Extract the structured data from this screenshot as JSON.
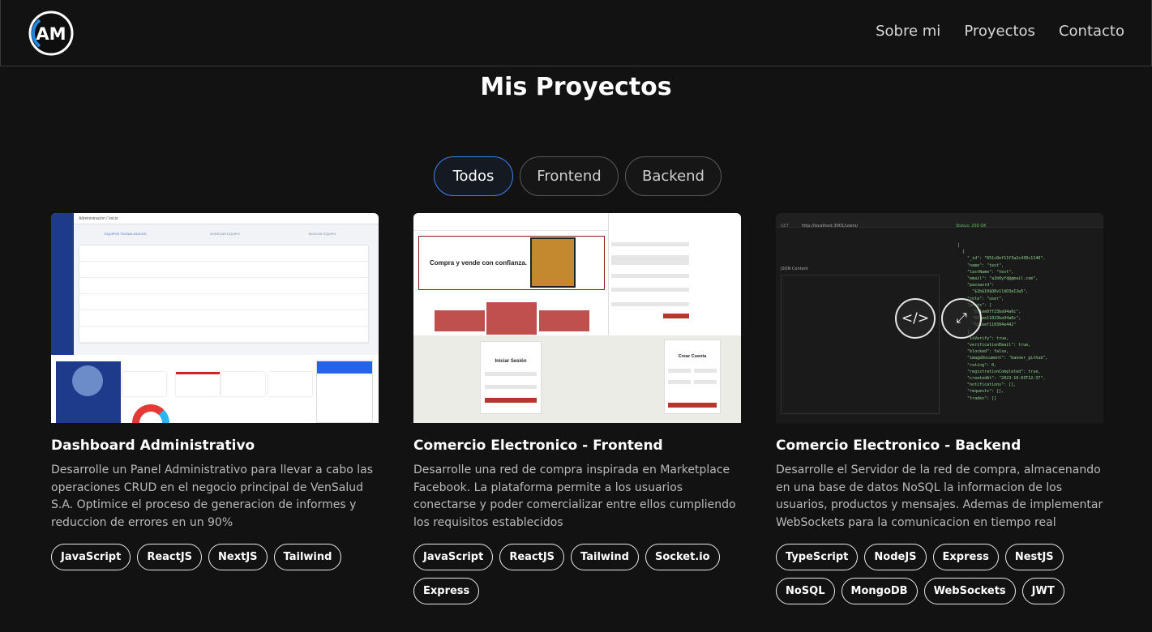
{
  "header": {
    "logo_text": "AM",
    "nav": [
      "Sobre mi",
      "Proyectos",
      "Contacto"
    ]
  },
  "page_title": "Mis Proyectos",
  "filters": [
    "Todos",
    "Frontend",
    "Backend"
  ],
  "active_filter": "Todos",
  "projects": [
    {
      "title": "Dashboard Administrativo",
      "description": "Desarrolle un Panel Administrativo para llevar a cabo las operaciones CRUD en el negocio principal de VenSalud S.A. Optimice el proceso de generacion de informes y reduccion de errores en un 90%",
      "tags": [
        "JavaScript",
        "ReactJS",
        "NextJS",
        "Tailwind"
      ]
    },
    {
      "title": "Comercio Electronico - Frontend",
      "description": "Desarrolle una red de compra inspirada en Marketplace Facebook. La plataforma permite a los usuarios conectarse y poder comercializar entre ellos cumpliendo los requisitos establecidos",
      "tags": [
        "JavaScript",
        "ReactJS",
        "Tailwind",
        "Socket.io",
        "Express"
      ],
      "screenshot": {
        "banner": "Compra y vende con confianza.",
        "login_title": "Iniciar Sesión",
        "register_title": "Crear Cuenta"
      }
    },
    {
      "title": "Comercio Electronico - Backend",
      "description": "Desarrolle el Servidor de la red de compra, almacenando en una base de datos NoSQL la informacion de los usuarios, productos y mensajes. Ademas de implementar WebSockets para la comunicacion en tiempo real",
      "tags": [
        "TypeScript",
        "NodeJS",
        "Express",
        "NestJS",
        "NoSQL",
        "MongoDB",
        "WebSockets",
        "JWT"
      ],
      "screenshot": {
        "url": "http://localhost:3001/users/",
        "method": "GET",
        "status": "Status: 200 OK",
        "json_label": "JSON Content",
        "code_icon": "code-icon",
        "expand_icon": "expand-icon"
      }
    }
  ],
  "colors": {
    "background": "#121212",
    "active_border": "#3b82f6"
  }
}
